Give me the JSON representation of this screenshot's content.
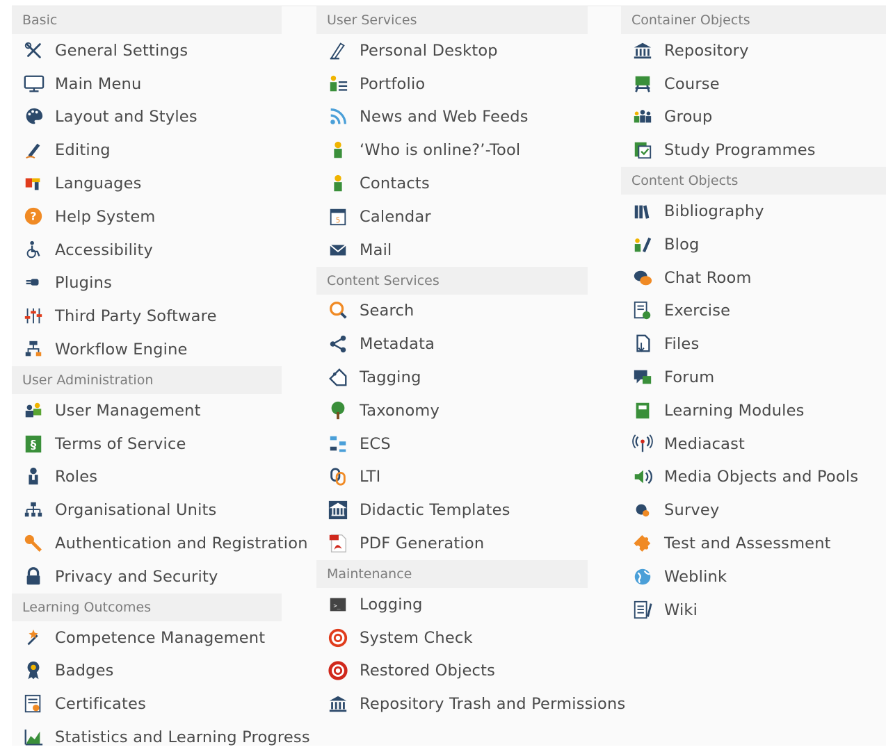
{
  "columns": [
    {
      "sections": [
        {
          "title": "Basic",
          "items": [
            {
              "label": "General Settings",
              "icon": "tools-icon"
            },
            {
              "label": "Main Menu",
              "icon": "monitor-icon"
            },
            {
              "label": "Layout and Styles",
              "icon": "palette-icon"
            },
            {
              "label": "Editing",
              "icon": "pen-icon"
            },
            {
              "label": "Languages",
              "icon": "languages-icon"
            },
            {
              "label": "Help System",
              "icon": "help-icon"
            },
            {
              "label": "Accessibility",
              "icon": "wheelchair-icon"
            },
            {
              "label": "Plugins",
              "icon": "plug-icon"
            },
            {
              "label": "Third Party Software",
              "icon": "sliders-icon"
            },
            {
              "label": "Workflow Engine",
              "icon": "workflow-icon"
            }
          ]
        },
        {
          "title": "User Administration",
          "items": [
            {
              "label": "User Management",
              "icon": "users-icon"
            },
            {
              "label": "Terms of Service",
              "icon": "section-icon"
            },
            {
              "label": "Roles",
              "icon": "role-icon"
            },
            {
              "label": "Organisational Units",
              "icon": "org-units-icon"
            },
            {
              "label": "Authentication and Registration",
              "icon": "key-icon"
            },
            {
              "label": "Privacy and Security",
              "icon": "lock-icon"
            }
          ]
        },
        {
          "title": "Learning Outcomes",
          "items": [
            {
              "label": "Competence Management",
              "icon": "wand-icon"
            },
            {
              "label": "Badges",
              "icon": "badge-icon"
            },
            {
              "label": "Certificates",
              "icon": "certificate-icon"
            },
            {
              "label": "Statistics and Learning Progress",
              "icon": "chart-icon"
            }
          ]
        }
      ]
    },
    {
      "sections": [
        {
          "title": "User Services",
          "items": [
            {
              "label": "Personal Desktop",
              "icon": "desktop-icon"
            },
            {
              "label": "Portfolio",
              "icon": "portfolio-icon"
            },
            {
              "label": "News and Web Feeds",
              "icon": "rss-icon"
            },
            {
              "label": "‘Who is online?’-Tool",
              "icon": "person-icon"
            },
            {
              "label": "Contacts",
              "icon": "contacts-icon"
            },
            {
              "label": "Calendar",
              "icon": "calendar-icon"
            },
            {
              "label": "Mail",
              "icon": "mail-icon"
            }
          ]
        },
        {
          "title": "Content Services",
          "items": [
            {
              "label": "Search",
              "icon": "search-icon"
            },
            {
              "label": "Metadata",
              "icon": "share-icon"
            },
            {
              "label": "Tagging",
              "icon": "tag-icon"
            },
            {
              "label": "Taxonomy",
              "icon": "tree-icon"
            },
            {
              "label": "ECS",
              "icon": "ecs-icon"
            },
            {
              "label": "LTI",
              "icon": "lti-icon"
            },
            {
              "label": "Didactic Templates",
              "icon": "template-icon"
            },
            {
              "label": "PDF Generation",
              "icon": "pdf-icon"
            }
          ]
        },
        {
          "title": "Maintenance",
          "items": [
            {
              "label": "Logging",
              "icon": "terminal-icon"
            },
            {
              "label": "System Check",
              "icon": "lifebuoy-icon"
            },
            {
              "label": "Restored Objects",
              "icon": "lifebuoy-red-icon"
            },
            {
              "label": "Repository Trash and Permissions",
              "icon": "bank-icon"
            }
          ]
        }
      ]
    },
    {
      "sections": [
        {
          "title": "Container Objects",
          "items": [
            {
              "label": "Repository",
              "icon": "bank-icon"
            },
            {
              "label": "Course",
              "icon": "course-icon"
            },
            {
              "label": "Group",
              "icon": "group-icon"
            },
            {
              "label": "Study Programmes",
              "icon": "study-icon"
            }
          ]
        },
        {
          "title": "Content Objects",
          "items": [
            {
              "label": "Bibliography",
              "icon": "books-icon"
            },
            {
              "label": "Blog",
              "icon": "blog-icon"
            },
            {
              "label": "Chat Room",
              "icon": "chat-icon"
            },
            {
              "label": "Exercise",
              "icon": "exercise-icon"
            },
            {
              "label": "Files",
              "icon": "files-icon"
            },
            {
              "label": "Forum",
              "icon": "forum-icon"
            },
            {
              "label": "Learning Modules",
              "icon": "module-icon"
            },
            {
              "label": "Mediacast",
              "icon": "mediacast-icon"
            },
            {
              "label": "Media Objects and Pools",
              "icon": "speaker-icon"
            },
            {
              "label": "Survey",
              "icon": "survey-icon"
            },
            {
              "label": "Test and Assessment",
              "icon": "puzzle-icon"
            },
            {
              "label": "Weblink",
              "icon": "globe-icon"
            },
            {
              "label": "Wiki",
              "icon": "wiki-icon"
            }
          ]
        }
      ]
    }
  ]
}
